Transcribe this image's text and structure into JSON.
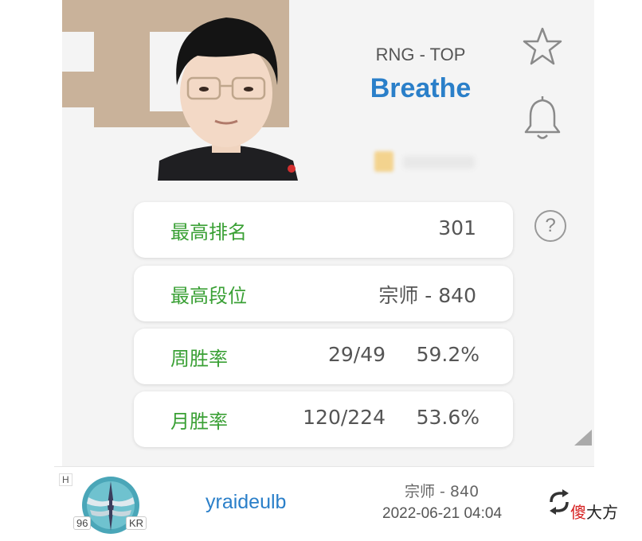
{
  "player": {
    "team_role": "RNG - TOP",
    "name": "Breathe"
  },
  "header": {
    "favorite_icon": "star-outline-icon",
    "notification_icon": "bell-outline-icon",
    "help_icon": "question-circle-icon",
    "help_symbol": "?"
  },
  "stats": {
    "peak_rank": {
      "label": "最高排名",
      "value": "301"
    },
    "peak_tier": {
      "label": "最高段位",
      "value": "宗师 - 840"
    },
    "weekly_winrate": {
      "label": "周胜率",
      "games": "29/49",
      "rate": "59.2%"
    },
    "monthly_winrate": {
      "label": "月胜率",
      "games": "120/224",
      "rate": "53.6%"
    }
  },
  "account": {
    "region_tag": "H",
    "level": "96",
    "server": "KR",
    "name": "yraideulb",
    "rank": "宗师 - 840",
    "time": "2022-06-21 04:04",
    "refresh_icon": "refresh-icon"
  },
  "watermark": {
    "red": "傻",
    "black": "大方"
  },
  "colors": {
    "accent_blue": "#2a7fc9",
    "label_green": "#3aa035",
    "logo_tan": "#c9b29a"
  }
}
